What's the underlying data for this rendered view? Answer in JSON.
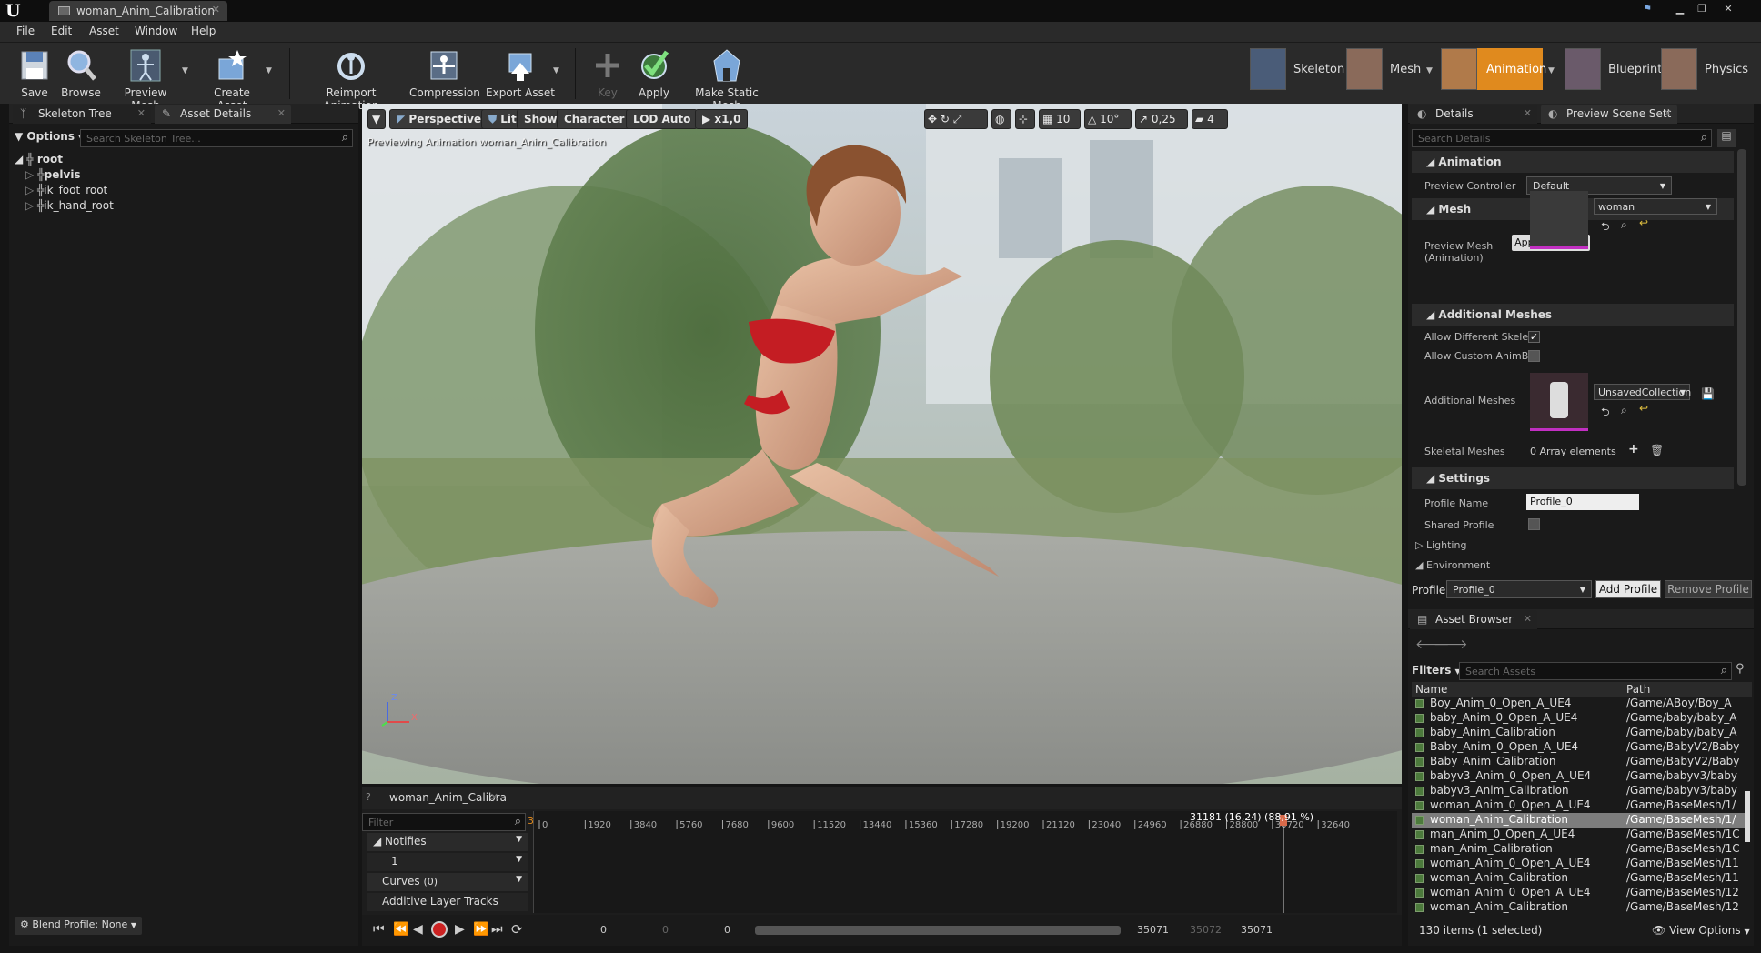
{
  "window": {
    "title": "woman_Anim_Calibration"
  },
  "menu": [
    "File",
    "Edit",
    "Asset",
    "Window",
    "Help"
  ],
  "toolbar": {
    "left": [
      {
        "label": "Save",
        "icon": "save-icon"
      },
      {
        "label": "Browse",
        "icon": "browse-icon"
      },
      {
        "label": "Preview Mesh",
        "icon": "preview-mesh-icon"
      },
      {
        "label": "Create Asset",
        "icon": "create-asset-icon"
      },
      {
        "label": "Reimport Animation",
        "icon": "reimport-icon"
      },
      {
        "label": "Compression",
        "icon": "compression-icon"
      },
      {
        "label": "Export Asset",
        "icon": "export-icon"
      },
      {
        "label": "Key",
        "icon": "key-plus-icon"
      },
      {
        "label": "Apply",
        "icon": "apply-check-icon"
      },
      {
        "label": "Make Static Mesh",
        "icon": "make-static-mesh-icon"
      }
    ],
    "modes": [
      {
        "label": "Skeleton"
      },
      {
        "label": "Mesh"
      },
      {
        "label": "Animation"
      },
      {
        "label": "Blueprint"
      },
      {
        "label": "Physics"
      }
    ]
  },
  "skeleton_panel": {
    "tab1": "Skeleton Tree",
    "tab2": "Asset Details",
    "options": "Options",
    "search_placeholder": "Search Skeleton Tree...",
    "nodes": [
      "root",
      "pelvis",
      "ik_foot_root",
      "ik_hand_root"
    ],
    "blend_profile": "Blend Profile: None"
  },
  "viewport": {
    "buttons": [
      "Perspective",
      "Lit",
      "Show",
      "Character",
      "LOD Auto",
      "x1,0"
    ],
    "snap_values": [
      "10",
      "10°",
      "0,25",
      "4"
    ],
    "preview_text": "Previewing Animation woman_Anim_Calibration",
    "axis_z": "Z",
    "axis_x": "X"
  },
  "timeline": {
    "tab": "woman_Anim_Calibra",
    "filter_placeholder": "Filter",
    "current_frame": "31181",
    "current_readout": "31181 (16,24) (88,91 %)",
    "ticks": [
      "0",
      "1920",
      "3840",
      "5760",
      "7680",
      "9600",
      "11520",
      "13440",
      "15360",
      "17280",
      "19200",
      "21120",
      "23040",
      "24960",
      "26880",
      "28800",
      "30720",
      "32640"
    ],
    "tracks": {
      "notifies": "Notifies",
      "notify_num": "1",
      "curves": "Curves",
      "curves_count": "(0)",
      "additive": "Additive Layer Tracks"
    },
    "bottom": {
      "a": "0",
      "b": "0",
      "c": "0",
      "end1": "35071",
      "end2": "35072",
      "end3": "35071"
    },
    "playhead_fraction": 0.8891
  },
  "details": {
    "tab1": "Details",
    "tab2": "Preview Scene Sett",
    "search_placeholder": "Search Details",
    "animation": "Animation",
    "preview_controller_label": "Preview Controller",
    "preview_controller_value": "Default",
    "mesh": "Mesh",
    "preview_mesh_label": "Preview Mesh (Animation)",
    "preview_mesh_value": "woman",
    "apply_to_asset": "Apply To Asset",
    "additional_meshes": "Additional Meshes",
    "allow_different": "Allow Different Skelet",
    "allow_custom": "Allow Custom AnimBl",
    "additional_meshes_label": "Additional Meshes",
    "unsaved_collection": "UnsavedCollection",
    "skeletal_meshes_label": "Skeletal Meshes",
    "array_elements": "0 Array elements",
    "settings": "Settings",
    "profile_name_label": "Profile Name",
    "profile_name_value": "Profile_0",
    "shared_profile": "Shared Profile",
    "lighting": "Lighting",
    "environment": "Environment",
    "profile_label": "Profile",
    "profile_value": "Profile_0",
    "add_profile": "Add Profile",
    "remove_profile": "Remove Profile"
  },
  "asset_browser": {
    "tab": "Asset Browser",
    "filters": "Filters",
    "search_placeholder": "Search Assets",
    "col_name": "Name",
    "col_path": "Path",
    "rows": [
      {
        "name": "Boy_Anim_0_Open_A_UE4",
        "path": "/Game/ABoy/Boy_A"
      },
      {
        "name": "baby_Anim_0_Open_A_UE4",
        "path": "/Game/baby/baby_A"
      },
      {
        "name": "baby_Anim_Calibration",
        "path": "/Game/baby/baby_A"
      },
      {
        "name": "Baby_Anim_0_Open_A_UE4",
        "path": "/Game/BabyV2/Baby"
      },
      {
        "name": "Baby_Anim_Calibration",
        "path": "/Game/BabyV2/Baby"
      },
      {
        "name": "babyv3_Anim_0_Open_A_UE4",
        "path": "/Game/babyv3/baby"
      },
      {
        "name": "babyv3_Anim_Calibration",
        "path": "/Game/babyv3/baby"
      },
      {
        "name": "woman_Anim_0_Open_A_UE4",
        "path": "/Game/BaseMesh/1/"
      },
      {
        "name": "woman_Anim_Calibration",
        "path": "/Game/BaseMesh/1/",
        "selected": true
      },
      {
        "name": "man_Anim_0_Open_A_UE4",
        "path": "/Game/BaseMesh/1C"
      },
      {
        "name": "man_Anim_Calibration",
        "path": "/Game/BaseMesh/1C"
      },
      {
        "name": "woman_Anim_0_Open_A_UE4",
        "path": "/Game/BaseMesh/11"
      },
      {
        "name": "woman_Anim_Calibration",
        "path": "/Game/BaseMesh/11"
      },
      {
        "name": "woman_Anim_0_Open_A_UE4",
        "path": "/Game/BaseMesh/12"
      },
      {
        "name": "woman_Anim_Calibration",
        "path": "/Game/BaseMesh/12"
      }
    ],
    "status": "130 items (1 selected)",
    "view_options": "View Options"
  },
  "colors": {
    "accent": "#e08a1e",
    "panel": "#1a1a1a",
    "selected_row": "#7d7d7d",
    "timeline_marker": "#d86a4a"
  }
}
